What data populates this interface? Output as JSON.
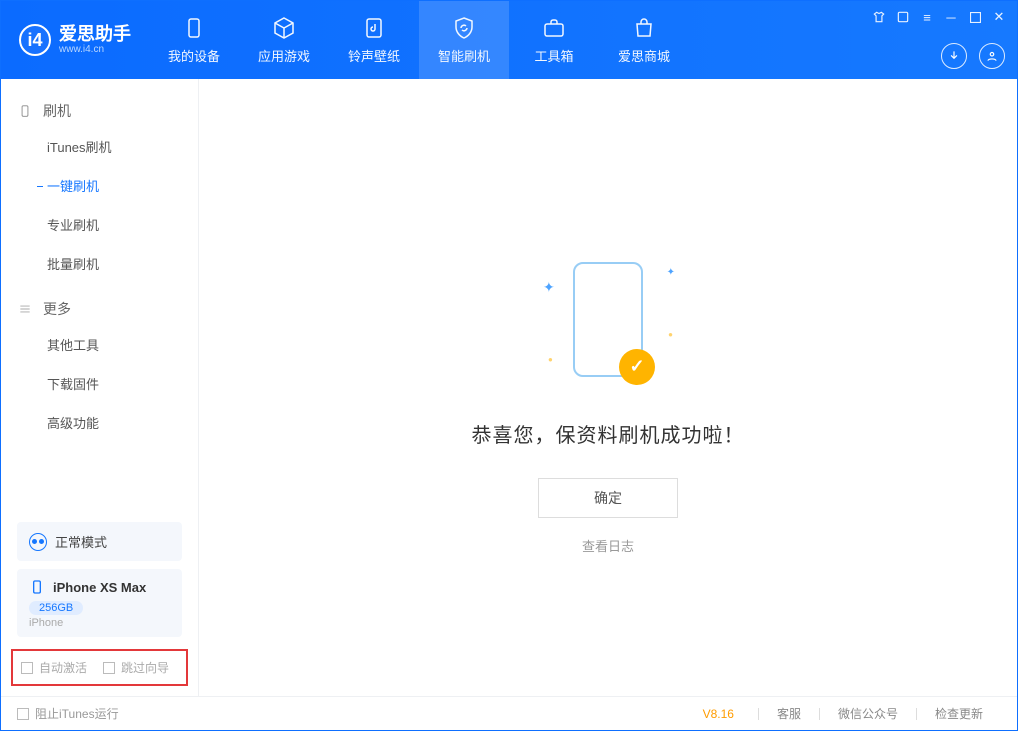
{
  "app": {
    "name": "爱思助手",
    "domain": "www.i4.cn"
  },
  "nav": {
    "items": [
      {
        "label": "我的设备",
        "icon": "device"
      },
      {
        "label": "应用游戏",
        "icon": "cube"
      },
      {
        "label": "铃声壁纸",
        "icon": "music"
      },
      {
        "label": "智能刷机",
        "icon": "shield"
      },
      {
        "label": "工具箱",
        "icon": "toolbox"
      },
      {
        "label": "爱思商城",
        "icon": "bag"
      }
    ],
    "active_index": 3
  },
  "sidebar": {
    "sections": [
      {
        "title": "刷机",
        "icon": "phone",
        "items": [
          "iTunes刷机",
          "一键刷机",
          "专业刷机",
          "批量刷机"
        ],
        "active_index": 1
      },
      {
        "title": "更多",
        "icon": "menu",
        "items": [
          "其他工具",
          "下载固件",
          "高级功能"
        ],
        "active_index": -1
      }
    ],
    "mode_label": "正常模式",
    "device": {
      "name": "iPhone XS Max",
      "storage": "256GB",
      "type": "iPhone"
    },
    "checks": {
      "auto_activate": "自动激活",
      "skip_guide": "跳过向导"
    }
  },
  "main": {
    "success_text": "恭喜您，保资料刷机成功啦！",
    "ok_label": "确定",
    "log_link": "查看日志"
  },
  "footer": {
    "block_itunes": "阻止iTunes运行",
    "version": "V8.16",
    "links": [
      "客服",
      "微信公众号",
      "检查更新"
    ]
  }
}
